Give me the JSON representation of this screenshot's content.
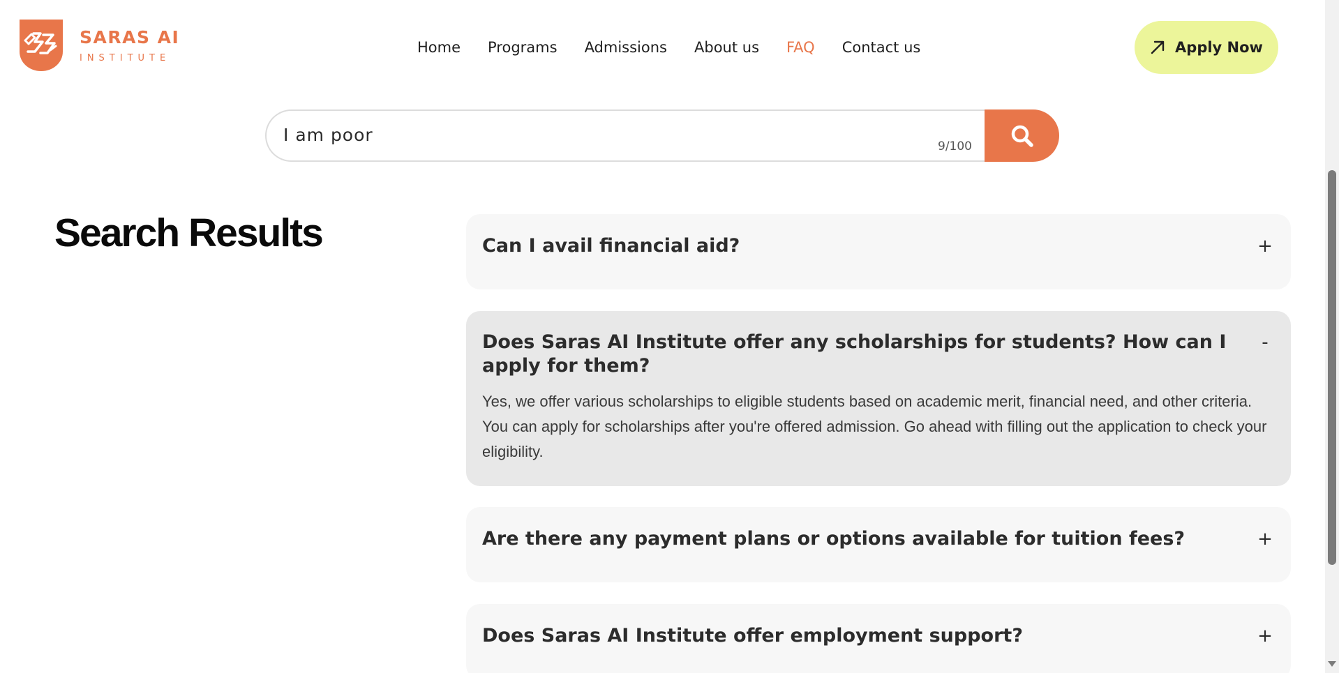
{
  "brand": {
    "name": "SARAS AI",
    "tagline": "INSTITUTE",
    "accent_color": "#e8764a",
    "cta_color": "#ecf59a"
  },
  "nav": {
    "items": [
      {
        "label": "Home",
        "active": false
      },
      {
        "label": "Programs",
        "active": false
      },
      {
        "label": "Admissions",
        "active": false
      },
      {
        "label": "About us",
        "active": false
      },
      {
        "label": "FAQ",
        "active": true
      },
      {
        "label": "Contact us",
        "active": false
      }
    ],
    "apply_label": "Apply Now",
    "apply_icon": "arrow-up-right-icon"
  },
  "search": {
    "value": "I am poor",
    "counter": "9/100",
    "button_icon": "search-icon"
  },
  "results": {
    "title": "Search Results",
    "faqs": [
      {
        "question": "Can I avail financial aid?",
        "toggle": "+",
        "expanded": false,
        "answer": ""
      },
      {
        "question": "Does Saras AI Institute offer any scholarships for students? How can I apply for them?",
        "toggle": "-",
        "expanded": true,
        "answer": "Yes, we offer various scholarships to eligible students based on academic merit, financial need, and other criteria. You can apply for scholarships after you're offered admission. Go ahead with filling out the application to check your eligibility."
      },
      {
        "question": "Are there any payment plans or options available for tuition fees?",
        "toggle": "+",
        "expanded": false,
        "answer": ""
      },
      {
        "question": "Does Saras AI Institute offer employment support?",
        "toggle": "+",
        "expanded": false,
        "answer": ""
      }
    ]
  }
}
